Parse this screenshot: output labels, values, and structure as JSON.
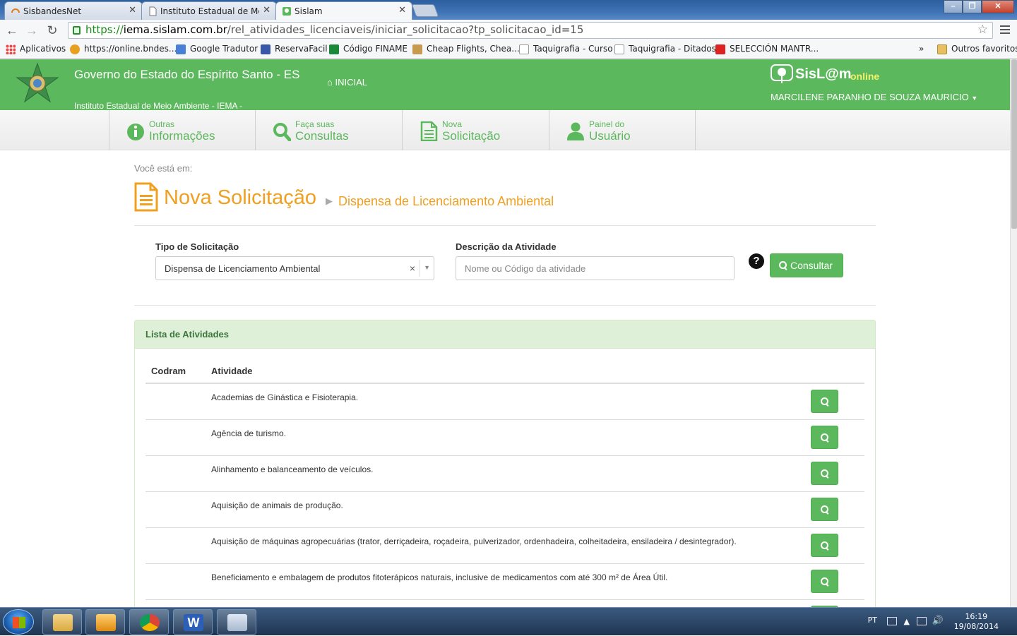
{
  "browser": {
    "tabs": [
      {
        "title": "SisbandesNet",
        "active": false
      },
      {
        "title": "Instituto Estadual de Meio",
        "active": false
      },
      {
        "title": "Sislam",
        "active": true
      }
    ],
    "url_scheme": "https://",
    "url_host": "iema.sislam.com.br",
    "url_path": "/rel_atividades_licenciaveis/iniciar_solicitacao?tp_solicitacao_id=15",
    "bookmarks": [
      {
        "label": "Aplicativos",
        "icon": "apps-grid-icon"
      },
      {
        "label": "https://online.bndes...",
        "icon": "bndes-icon"
      },
      {
        "label": "Google Tradutor",
        "icon": "translate-icon"
      },
      {
        "label": "ReservaFacil",
        "icon": "reservafacil-icon"
      },
      {
        "label": "Código FINAME",
        "icon": "finame-icon"
      },
      {
        "label": "Cheap Flights, Chea...",
        "icon": "flights-icon"
      },
      {
        "label": "Taquigrafia - Curso",
        "icon": "page-icon"
      },
      {
        "label": "Taquigrafia - Ditados",
        "icon": "page-icon"
      },
      {
        "label": "SELECCIÓN MANTR...",
        "icon": "youtube-icon"
      }
    ],
    "bookmarks_overflow": "»",
    "other_bookmarks": "Outros favoritos"
  },
  "header": {
    "gov_title": "Governo do Estado do Espírito Santo - ES",
    "gov_subtitle": "Instituto Estadual de Meio Ambiente - IEMA -",
    "home_link": "INICIAL",
    "brand_name": "SisL@m",
    "brand_suffix": "online",
    "user_name": "MARCILENE PARANHO DE SOUZA MAURICIO"
  },
  "nav": [
    {
      "small": "Outras",
      "big": "Informações",
      "icon": "info-icon"
    },
    {
      "small": "Faça suas",
      "big": "Consultas",
      "icon": "search-icon"
    },
    {
      "small": "Nova",
      "big": "Solicitação",
      "icon": "document-icon"
    },
    {
      "small": "Painel do",
      "big": "Usuário",
      "icon": "user-icon"
    }
  ],
  "breadcrumb": "Você está em:",
  "page": {
    "title": "Nova Solicitação",
    "separator": "▶",
    "subtitle": "Dispensa de Licenciamento Ambiental"
  },
  "form": {
    "tipo_label": "Tipo de Solicitação",
    "tipo_value": "Dispensa de Licenciamento Ambiental",
    "descricao_label": "Descrição da Atividade",
    "descricao_placeholder": "Nome ou Código da atividade",
    "help": "?",
    "consultar_label": "Consultar"
  },
  "list": {
    "heading": "Lista de Atividades",
    "columns": {
      "codram": "Codram",
      "atividade": "Atividade"
    },
    "rows": [
      {
        "codram": "",
        "atividade": "Academias de Ginástica e Fisioterapia."
      },
      {
        "codram": "",
        "atividade": "Agência de turismo."
      },
      {
        "codram": "",
        "atividade": "Alinhamento e balanceamento de veículos."
      },
      {
        "codram": "",
        "atividade": "Aquisição de animais de produção."
      },
      {
        "codram": "",
        "atividade": "Aquisição de máquinas agropecuárias (trator, derriçadeira, roçadeira, pulverizador, ordenhadeira, colheitadeira, ensiladeira / desintegrador)."
      },
      {
        "codram": "",
        "atividade": "Beneficiamento e embalagem de produtos fitoterápicos naturais, inclusive de medicamentos com até 300 m² de Área Útil."
      }
    ]
  },
  "taskbar": {
    "apps": [
      "explorer-icon",
      "outlook-icon",
      "chrome-icon",
      "word-icon",
      "calculator-icon"
    ],
    "language": "PT",
    "time": "16:19",
    "date": "19/08/2014"
  },
  "colors": {
    "green": "#5cb85c",
    "orange": "#f0a020",
    "panel_heading": "#dff0d8"
  }
}
